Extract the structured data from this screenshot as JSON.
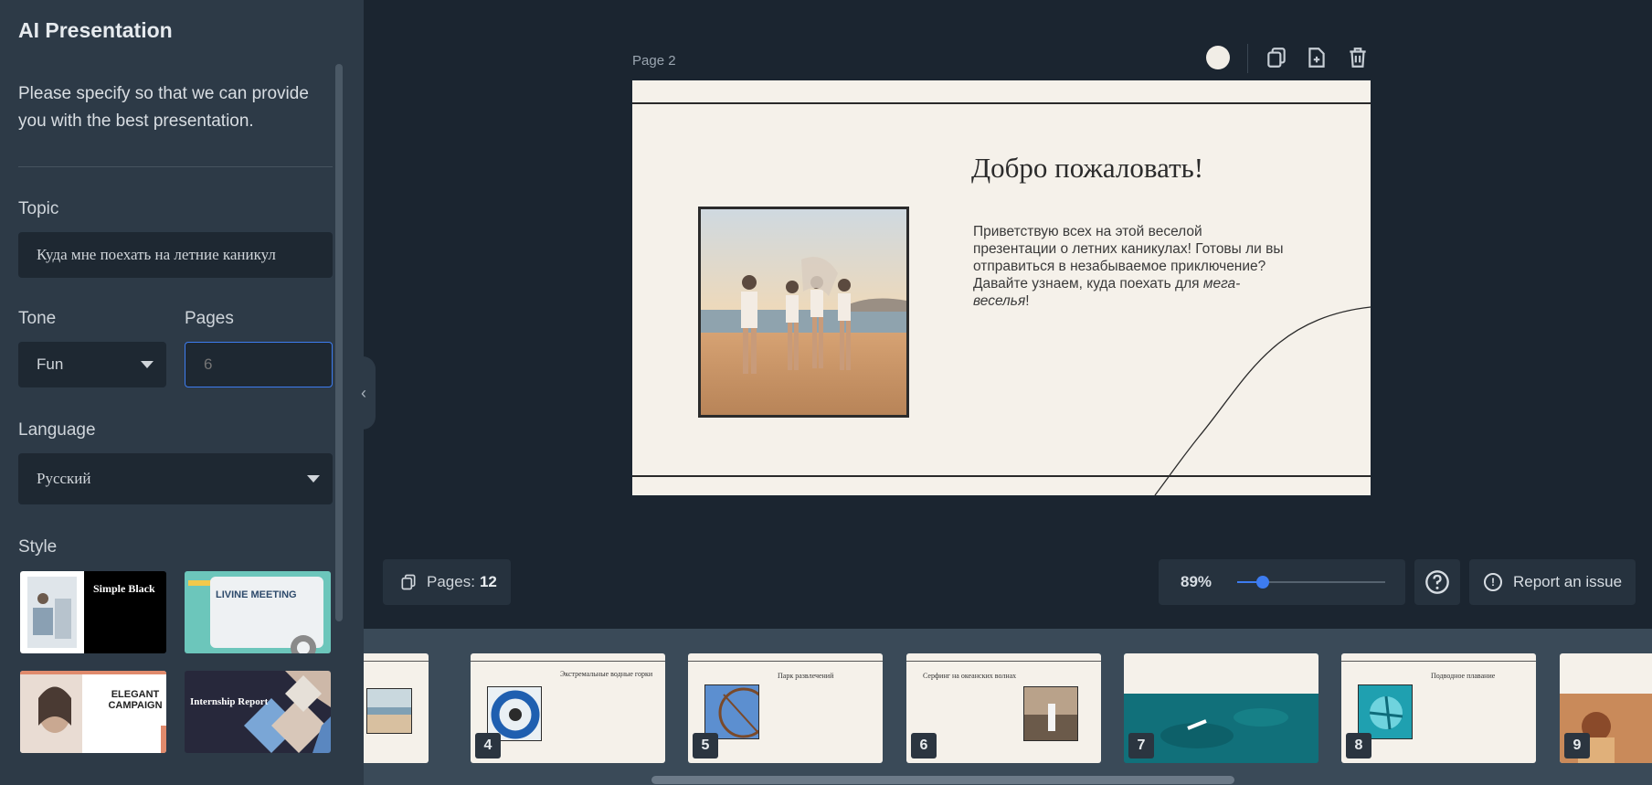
{
  "sidebar": {
    "title": "AI Presentation",
    "description": "Please specify so that we can provide you with the best presentation.",
    "topic": {
      "label": "Topic",
      "value": "Куда мне поехать на летние каникул"
    },
    "tone": {
      "label": "Tone",
      "value": "Fun"
    },
    "pages": {
      "label": "Pages",
      "placeholder": "6"
    },
    "language": {
      "label": "Language",
      "value": "Русский"
    },
    "style": {
      "label": "Style",
      "cards": [
        {
          "name": "Simple Black"
        },
        {
          "name": "LIVINE MEETING"
        },
        {
          "name": "ELEGANT CAMPAIGN"
        },
        {
          "name": "Internship Report"
        }
      ]
    }
  },
  "editor": {
    "page_label": "Page 2",
    "slide": {
      "title": "Добро пожаловать!",
      "body_main": "Приветствую всех на этой веселой презентации о летних каникулах! Готовы ли вы отправиться в незабываемое приключение? Давайте узнаем, куда поехать для ",
      "body_italic": "мега-веселья",
      "body_end": "!"
    }
  },
  "controls": {
    "pages_label": "Pages:",
    "pages_count": "12",
    "zoom_label": "89%",
    "zoom_fraction": 0.17,
    "report_label": "Report an issue",
    "accent_color": "#3d7cf0"
  },
  "thumbnails": [
    {
      "num": "",
      "title": ""
    },
    {
      "num": "4",
      "title": "Экстремальные водные горки"
    },
    {
      "num": "5",
      "title": "Парк развлечений"
    },
    {
      "num": "6",
      "title": "Серфинг на океанских волнах"
    },
    {
      "num": "7",
      "title": ""
    },
    {
      "num": "8",
      "title": "Подводное плавание"
    },
    {
      "num": "9",
      "title": ""
    }
  ]
}
